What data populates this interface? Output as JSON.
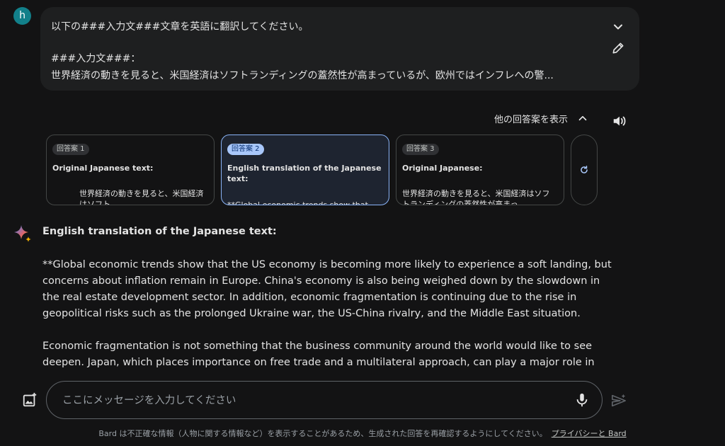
{
  "user": {
    "avatar_letter": "h"
  },
  "prompt": {
    "line1": "以下の###入力文###文章を英語に翻訳してください。",
    "line3": "###入力文###：",
    "line4": "世界経済の動きを見ると、米国経済はソフトランディングの蓋然性が高まっているが、欧州ではインフレへの警..."
  },
  "drafts": {
    "toggle_label": "他の回答案を表示",
    "cards": [
      {
        "badge": "回答案 1",
        "title": "Original Japanese text:",
        "body": "世界経済の動きを見ると、米国経済はソフト"
      },
      {
        "badge": "回答案 2",
        "title": "English translation of the Japanese text:",
        "body": "**Global economic trends show that"
      },
      {
        "badge": "回答案 3",
        "title": "Original Japanese:",
        "body": "世界経済の動きを見ると、米国経済はソフトランディングの蓋然性が高まっ"
      }
    ]
  },
  "response": {
    "title": "English translation of the Japanese text:",
    "paragraph1": "**Global economic trends show that the US economy is becoming more likely to experience a soft landing, but concerns about inflation remain in Europe. China's economy is also being weighed down by the slowdown in the real estate development sector. In addition, economic fragmentation is continuing due to the rise in geopolitical risks such as the prolonged Ukraine war, the US-China rivalry, and the Middle East situation.",
    "paragraph2": "Economic fragmentation is not something that the business community around the world would like to see deepen. Japan, which places importance on free trade and a multilateral approach, can play a major role in preventing this"
  },
  "input": {
    "placeholder": "ここにメッセージを入力してください"
  },
  "footer": {
    "text": "Bard は不正確な情報（人物に関する情報など）を表示することがあるため、生成された回答を再確認するようにしてください。",
    "link": "プライバシーと Bard"
  },
  "colors": {
    "background": "#131314",
    "surface": "#1e1f20",
    "accent": "#8ab4f8",
    "avatar": "#12808a"
  },
  "icons": [
    "chevron-down-icon",
    "edit-pencil-icon",
    "chevron-up-icon",
    "speaker-icon",
    "refresh-icon",
    "sparkle-icon",
    "add-image-icon",
    "microphone-icon",
    "send-icon"
  ]
}
